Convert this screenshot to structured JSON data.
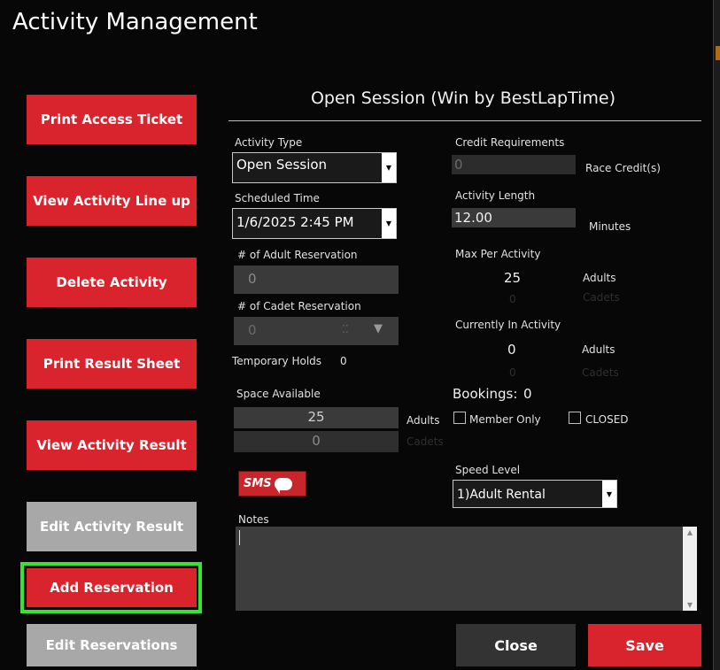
{
  "window": {
    "title": "Activity Management"
  },
  "sidebar": {
    "print_access_ticket": "Print Access Ticket",
    "view_activity_lineup": "View Activity Line up",
    "delete_activity": "Delete Activity",
    "print_result_sheet": "Print Result Sheet",
    "view_activity_result": "View Activity Result",
    "edit_activity_result": "Edit Activity Result",
    "add_reservation": "Add Reservation",
    "edit_reservations": "Edit Reservations"
  },
  "form": {
    "session_title": "Open Session (Win by BestLapTime)",
    "activity_type": {
      "label": "Activity Type",
      "value": "Open Session"
    },
    "scheduled_time": {
      "label": "Scheduled Time",
      "value": "1/6/2025 2:45 PM"
    },
    "adult_reservation": {
      "label": "# of Adult Reservation",
      "value": "0"
    },
    "cadet_reservation": {
      "label": "# of Cadet Reservation",
      "value": "0"
    },
    "temporary_holds": {
      "label": "Temporary Holds",
      "value": "0"
    },
    "space_available": {
      "label": "Space Available",
      "adults_value": "25",
      "adults_unit": "Adults",
      "cadets_value": "0",
      "cadets_unit": "Cadets"
    },
    "credit_requirements": {
      "label": "Credit Requirements",
      "value": "0",
      "unit": "Race Credit(s)"
    },
    "activity_length": {
      "label": "Activity Length",
      "value": "12.00",
      "unit": "Minutes"
    },
    "max_per_activity": {
      "label": "Max Per Activity",
      "adults_value": "25",
      "adults_unit": "Adults",
      "cadets_value": "0",
      "cadets_unit": "Cadets"
    },
    "currently_in_activity": {
      "label": "Currently In Activity",
      "adults_value": "0",
      "adults_unit": "Adults",
      "cadets_value": "0",
      "cadets_unit": "Cadets"
    },
    "bookings": {
      "label": "Bookings:",
      "value": "0"
    },
    "member_only": {
      "label": "Member Only",
      "checked": false
    },
    "closed": {
      "label": "CLOSED",
      "checked": false
    },
    "sms_button": {
      "label": "SMS",
      "icon": "speech-bubble-icon"
    },
    "speed_level": {
      "label": "Speed Level",
      "value": "1)Adult Rental"
    },
    "notes": {
      "label": "Notes",
      "value": ""
    }
  },
  "footer": {
    "close_label": "Close",
    "save_label": "Save"
  },
  "colors": {
    "accent_red": "#d9232d",
    "highlight_green": "#33e633",
    "disabled_gray": "#a8a8a8",
    "background": "#070707"
  }
}
